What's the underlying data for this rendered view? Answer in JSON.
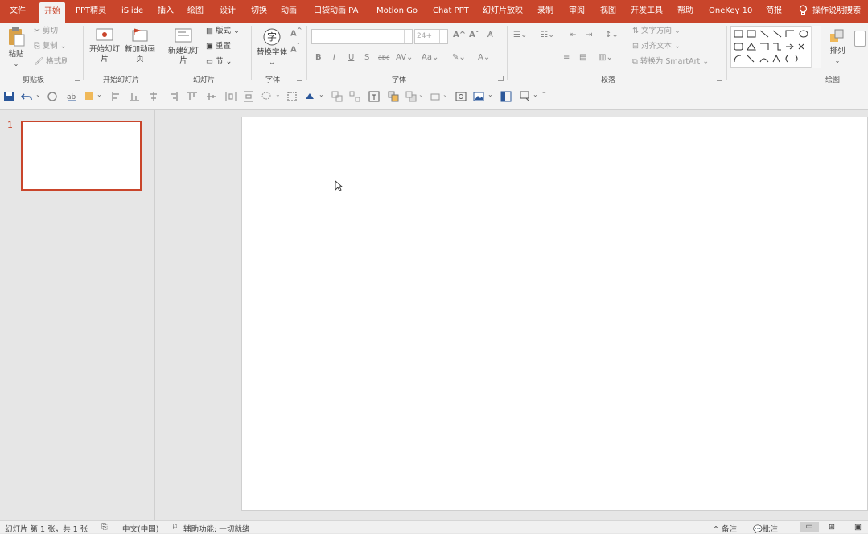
{
  "tabs": [
    "文件",
    "开始",
    "PPT精灵",
    "iSlide",
    "插入",
    "绘图",
    "设计",
    "切换",
    "动画",
    "口袋动画 PA",
    "Motion Go",
    "Chat PPT",
    "幻灯片放映",
    "录制",
    "审阅",
    "视图",
    "开发工具",
    "帮助",
    "OneKey 10",
    "简报"
  ],
  "tell_me": "操作说明搜索",
  "ribbon": {
    "clipboard": {
      "paste": "粘贴",
      "cut": "剪切",
      "copy": "复制",
      "format_painter": "格式刷",
      "label": "剪贴板"
    },
    "new_slides_group": {
      "start_slide": "开始幻灯片",
      "add_anim": "新加动画页",
      "label": "开始幻灯片"
    },
    "slides": {
      "new_slide": "新建幻灯片",
      "layout": "版式",
      "reset": "重置",
      "section": "节",
      "label": "幻灯片"
    },
    "font_group": {
      "replace_font": "替换字体",
      "label": "字体"
    },
    "font": {
      "size": "24+",
      "label": "字体"
    },
    "paragraph": {
      "text_direction": "文字方向",
      "align_text": "对齐文本",
      "smartart": "转换为 SmartArt",
      "label": "段落"
    },
    "drawing": {
      "arrange": "排列",
      "label": "绘图"
    }
  },
  "thumbnails": [
    {
      "number": "1"
    }
  ],
  "status": {
    "slide_info": "幻灯片 第 1 张，共 1 张",
    "language": "中文(中国)",
    "accessibility": "辅助功能: 一切就绪",
    "notes": "备注",
    "comments": "批注"
  },
  "colors": {
    "accent": "#c9452b",
    "ribbon_bg": "#f3f3f3",
    "workspace_bg": "#e6e6e6"
  }
}
